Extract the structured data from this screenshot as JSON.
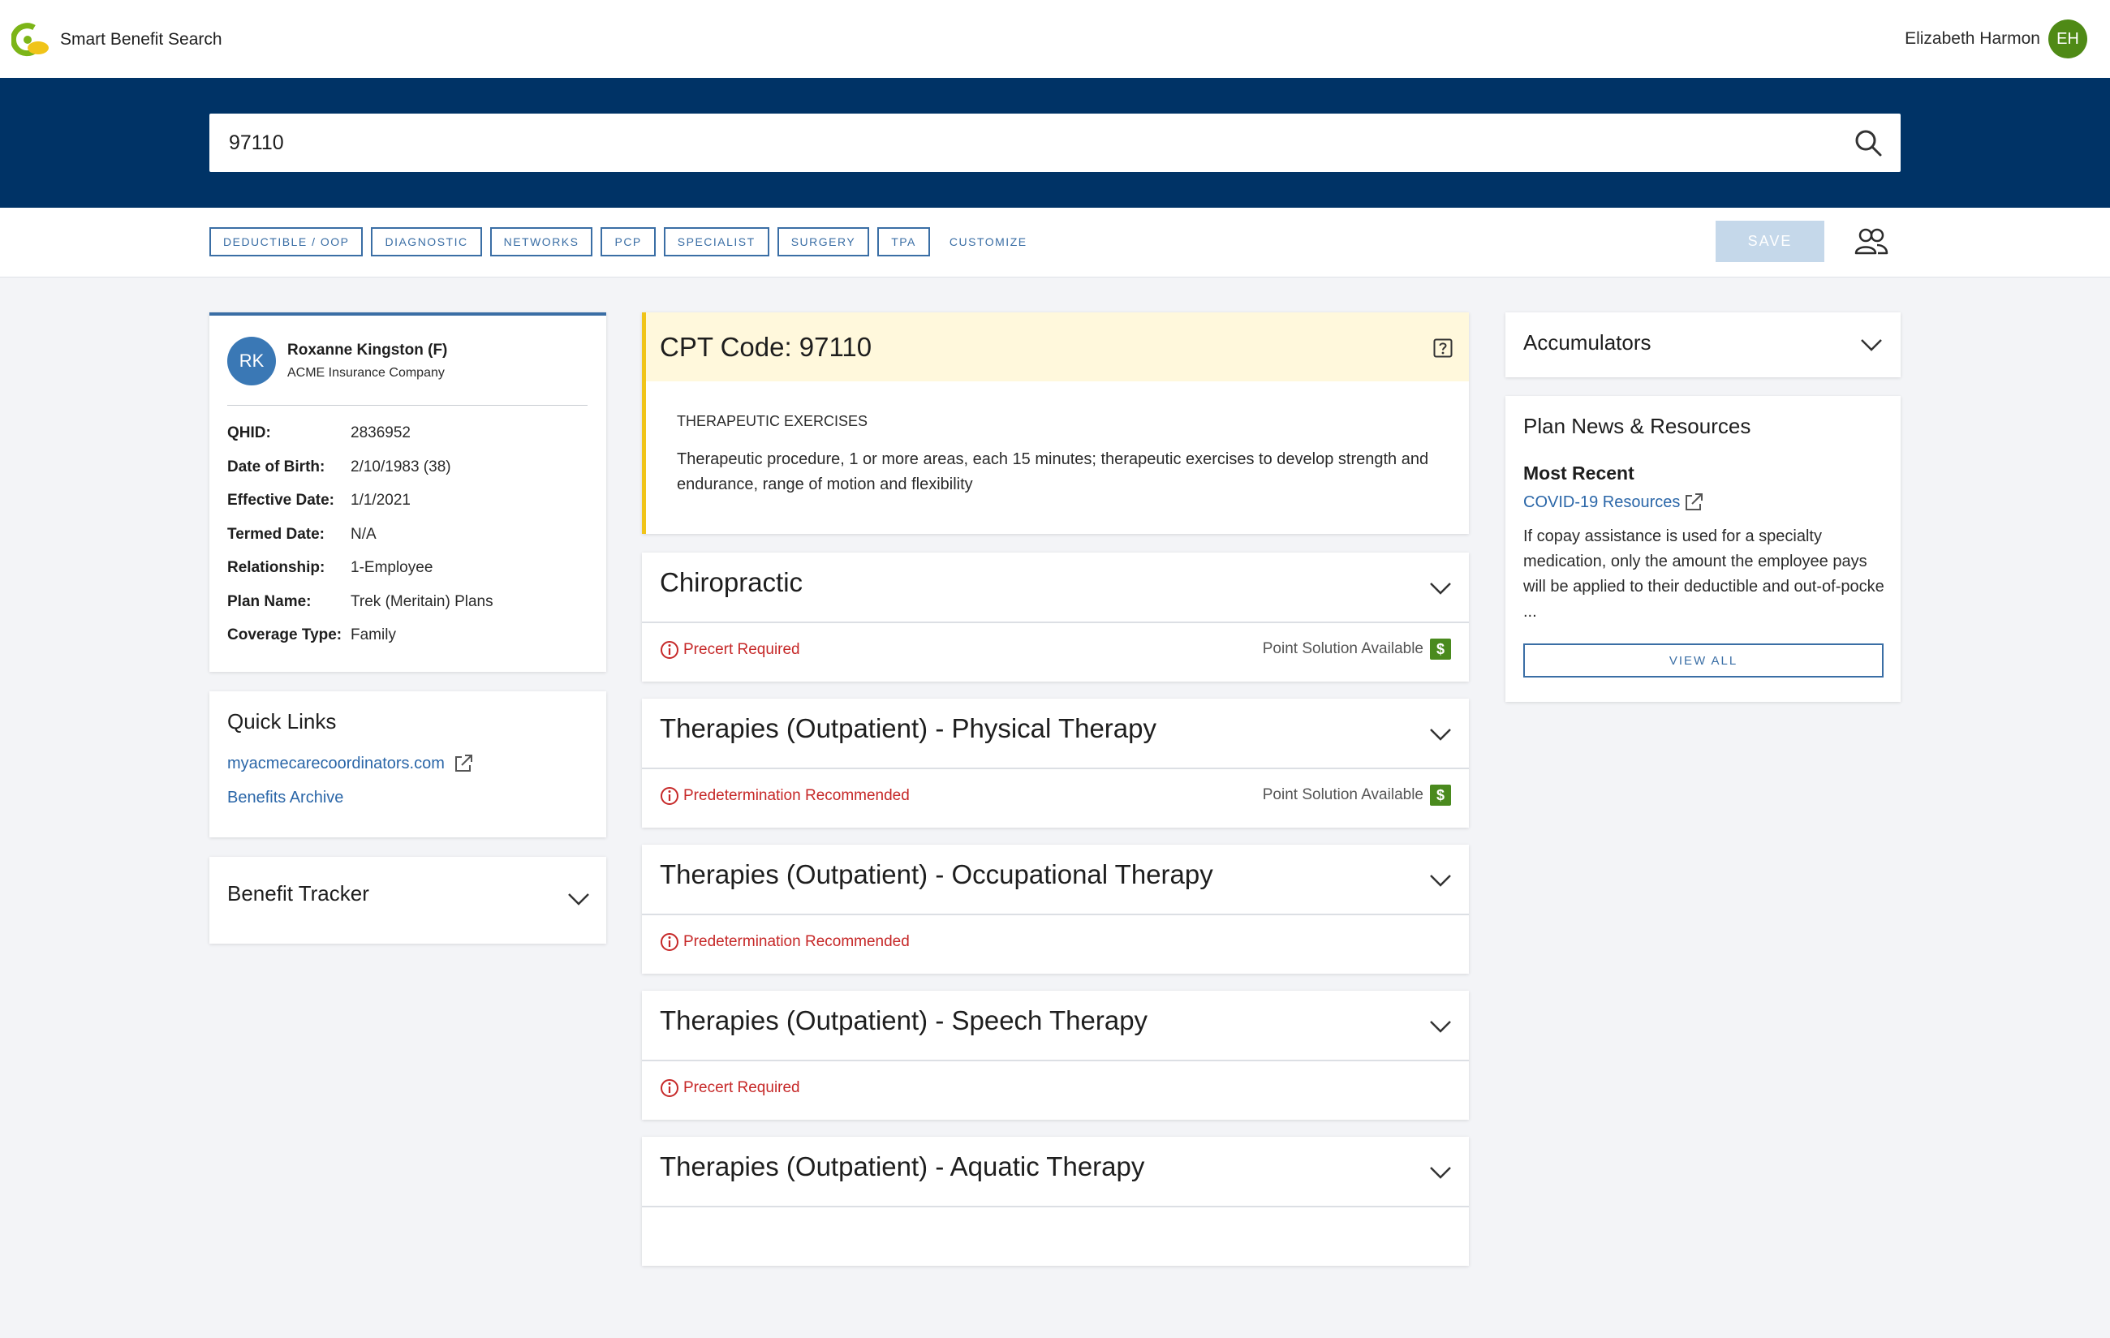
{
  "header": {
    "app_title": "Smart Benefit Search",
    "user_name": "Elizabeth Harmon",
    "user_initials": "EH"
  },
  "search": {
    "value": "97110"
  },
  "filters": {
    "chips": [
      "DEDUCTIBLE / OOP",
      "DIAGNOSTIC",
      "NETWORKS",
      "PCP",
      "SPECIALIST",
      "SURGERY",
      "TPA"
    ],
    "customize_label": "CUSTOMIZE",
    "save_label": "SAVE"
  },
  "member": {
    "initials": "RK",
    "name": "Roxanne Kingston (F)",
    "company": "ACME Insurance Company",
    "fields": [
      {
        "label": "QHID:",
        "value": "2836952"
      },
      {
        "label": "Date of Birth:",
        "value": "2/10/1983 (38)"
      },
      {
        "label": "Effective Date:",
        "value": "1/1/2021"
      },
      {
        "label": "Termed Date:",
        "value": "N/A"
      },
      {
        "label": "Relationship:",
        "value": "1-Employee"
      },
      {
        "label": "Plan Name:",
        "value": "Trek (Meritain) Plans"
      },
      {
        "label": "Coverage Type:",
        "value": "Family"
      }
    ]
  },
  "quick_links": {
    "title": "Quick Links",
    "links": [
      "myacmecarecoordinators.com",
      "Benefits Archive"
    ]
  },
  "benefit_tracker": {
    "title": "Benefit Tracker"
  },
  "cpt": {
    "title": "CPT Code: 97110",
    "subtitle": "THERAPEUTIC EXERCISES",
    "description": "Therapeutic procedure, 1 or more areas, each 15 minutes; therapeutic exercises to develop strength and endurance, range of motion and flexibility"
  },
  "benefits": [
    {
      "title": "Chiropractic",
      "status": "Precert Required",
      "point_solution": "Point Solution Available"
    },
    {
      "title": "Therapies (Outpatient) - Physical Therapy",
      "status": "Predetermination Recommended",
      "point_solution": "Point Solution Available"
    },
    {
      "title": "Therapies (Outpatient) - Occupational Therapy",
      "status": "Predetermination Recommended",
      "point_solution": ""
    },
    {
      "title": "Therapies (Outpatient) - Speech Therapy",
      "status": "Precert Required",
      "point_solution": ""
    },
    {
      "title": "Therapies (Outpatient) - Aquatic Therapy",
      "status": "",
      "point_solution": ""
    }
  ],
  "accumulators": {
    "title": "Accumulators"
  },
  "news": {
    "title": "Plan News & Resources",
    "most_recent_label": "Most Recent",
    "link": "COVID-19 Resources",
    "text": "If copay assistance is used for a specialty medication, only the amount the employee pays will be applied to their deductible and out-of-pocke ...",
    "view_all_label": "VIEW ALL"
  },
  "colors": {
    "header_band": "#003366",
    "accent_blue": "#3a6ea5",
    "status_red": "#c62828",
    "point_solution_green": "#4a8a1e",
    "cpt_highlight": "#fff8dc",
    "cpt_border": "#f0c419"
  }
}
